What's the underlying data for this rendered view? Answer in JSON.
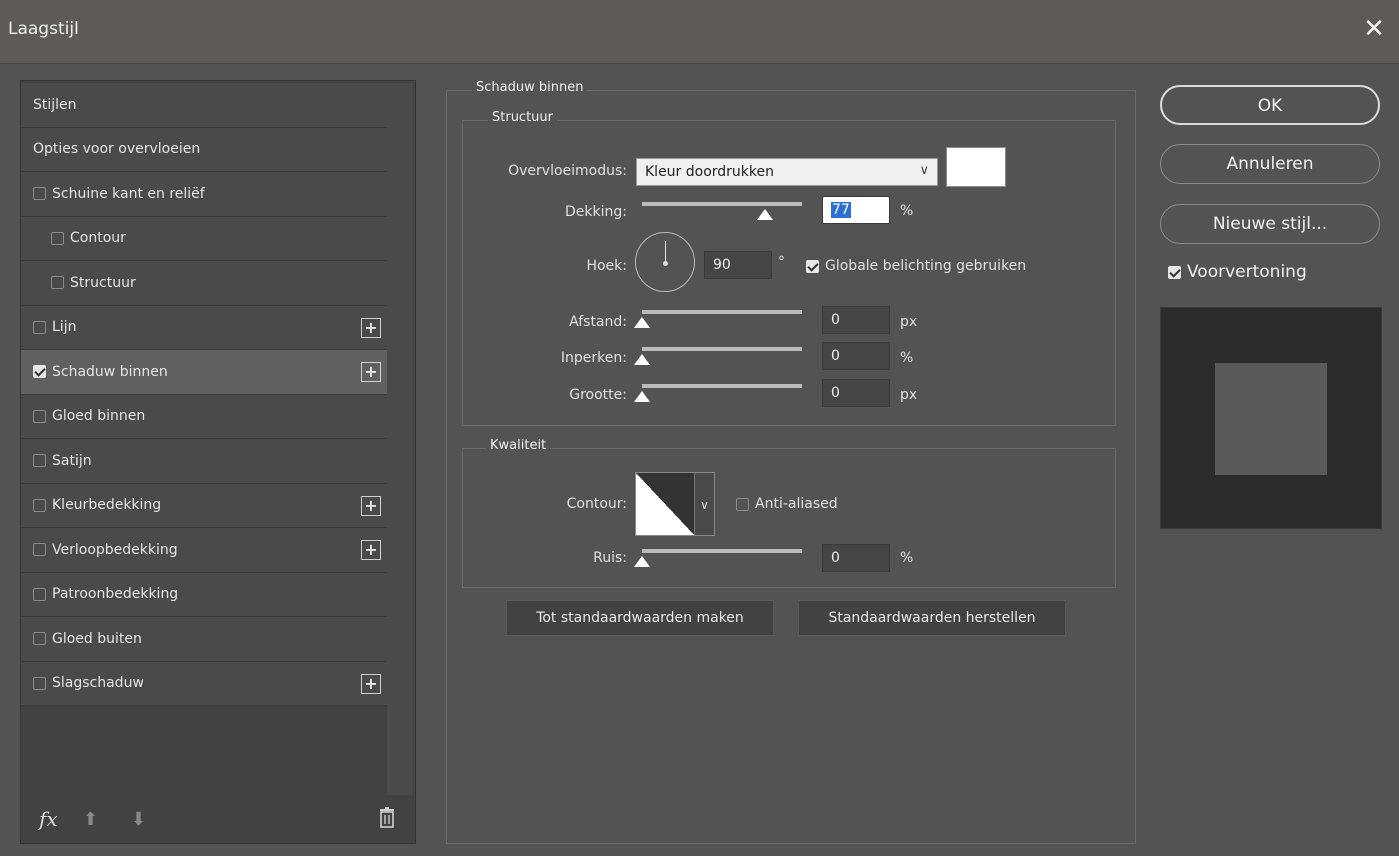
{
  "window": {
    "title": "Laagstijl",
    "close_glyph": "✕"
  },
  "sidebar": {
    "items": [
      {
        "label": "Stijlen",
        "checkbox": false,
        "checked": false,
        "indent": false,
        "plus": false,
        "selected": false
      },
      {
        "label": "Opties voor overvloeien",
        "checkbox": false,
        "checked": false,
        "indent": false,
        "plus": false,
        "selected": false
      },
      {
        "label": "Schuine kant en reliëf",
        "checkbox": true,
        "checked": false,
        "indent": false,
        "plus": false,
        "selected": false
      },
      {
        "label": "Contour",
        "checkbox": true,
        "checked": false,
        "indent": true,
        "plus": false,
        "selected": false
      },
      {
        "label": "Structuur",
        "checkbox": true,
        "checked": false,
        "indent": true,
        "plus": false,
        "selected": false
      },
      {
        "label": "Lijn",
        "checkbox": true,
        "checked": false,
        "indent": false,
        "plus": true,
        "selected": false
      },
      {
        "label": "Schaduw binnen",
        "checkbox": true,
        "checked": true,
        "indent": false,
        "plus": true,
        "selected": true
      },
      {
        "label": "Gloed binnen",
        "checkbox": true,
        "checked": false,
        "indent": false,
        "plus": false,
        "selected": false
      },
      {
        "label": "Satijn",
        "checkbox": true,
        "checked": false,
        "indent": false,
        "plus": false,
        "selected": false
      },
      {
        "label": "Kleurbedekking",
        "checkbox": true,
        "checked": false,
        "indent": false,
        "plus": true,
        "selected": false
      },
      {
        "label": "Verloopbedekking",
        "checkbox": true,
        "checked": false,
        "indent": false,
        "plus": true,
        "selected": false
      },
      {
        "label": "Patroonbedekking",
        "checkbox": true,
        "checked": false,
        "indent": false,
        "plus": false,
        "selected": false
      },
      {
        "label": "Gloed buiten",
        "checkbox": true,
        "checked": false,
        "indent": false,
        "plus": false,
        "selected": false
      },
      {
        "label": "Slagschaduw",
        "checkbox": true,
        "checked": false,
        "indent": false,
        "plus": true,
        "selected": false
      }
    ],
    "plus_glyph": "+",
    "footer": {
      "fx_label": "fx",
      "up_glyph": "⬆",
      "down_glyph": "⬇"
    }
  },
  "panel": {
    "title": "Schaduw binnen",
    "structure": {
      "title": "Structuur",
      "blend_mode_label": "Overvloeimodus:",
      "blend_mode_value": "Kleur doordrukken",
      "blend_color": "#ffffff",
      "opacity_label": "Dekking:",
      "opacity_value": "77",
      "opacity_fraction": 0.77,
      "opacity_unit": "%",
      "angle_label": "Hoek:",
      "angle_value": "90",
      "angle_unit": "°",
      "global_light_label": "Globale belichting gebruiken",
      "global_light_checked": true,
      "distance_label": "Afstand:",
      "distance_value": "0",
      "distance_fraction": 0,
      "distance_unit": "px",
      "choke_label": "Inperken:",
      "choke_value": "0",
      "choke_fraction": 0,
      "choke_unit": "%",
      "size_label": "Grootte:",
      "size_value": "0",
      "size_fraction": 0,
      "size_unit": "px"
    },
    "quality": {
      "title": "Kwaliteit",
      "contour_label": "Contour:",
      "anti_aliased_label": "Anti-aliased",
      "anti_aliased_checked": false,
      "noise_label": "Ruis:",
      "noise_value": "0",
      "noise_fraction": 0,
      "noise_unit": "%"
    },
    "make_default_label": "Tot standaardwaarden maken",
    "reset_default_label": "Standaardwaarden herstellen"
  },
  "actions": {
    "ok_label": "OK",
    "cancel_label": "Annuleren",
    "new_style_label": "Nieuwe stijl...",
    "preview_label": "Voorvertoning",
    "preview_checked": true
  }
}
